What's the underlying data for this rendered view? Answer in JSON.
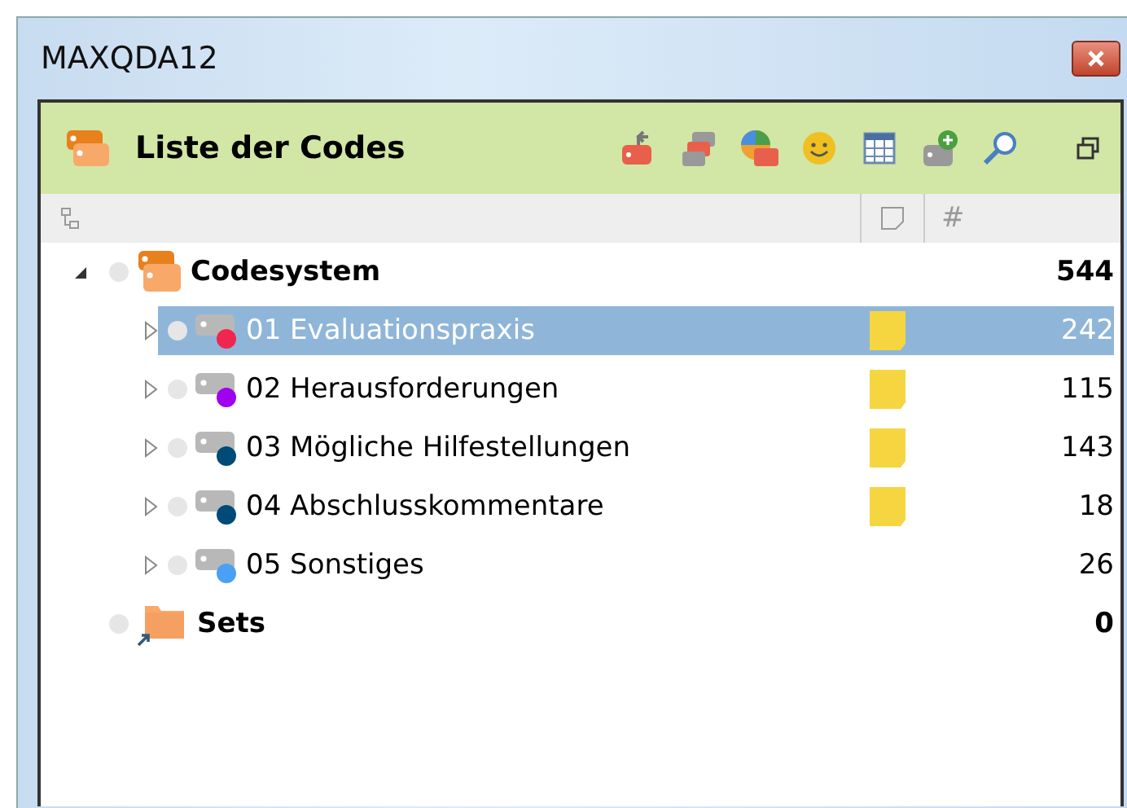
{
  "window": {
    "title": "MAXQDA12"
  },
  "panel": {
    "title": "Liste der Codes"
  },
  "columns": {
    "count_header": "#"
  },
  "tree": [
    {
      "label": "Codesystem",
      "kind": "codesystem",
      "expanded": true,
      "count": "544",
      "children": [
        {
          "label": "01 Evaluationspraxis",
          "selected": true,
          "memo": true,
          "color": "#f0264f",
          "count": "242"
        },
        {
          "label": "02 Herausforderungen",
          "selected": false,
          "memo": true,
          "color": "#a000f0",
          "count": "115"
        },
        {
          "label": "03 Mögliche Hilfestellungen",
          "selected": false,
          "memo": true,
          "color": "#004a78",
          "count": "143"
        },
        {
          "label": "04 Abschlusskommentare",
          "selected": false,
          "memo": true,
          "color": "#004a78",
          "count": "18"
        },
        {
          "label": "05 Sonstiges",
          "selected": false,
          "memo": false,
          "color": "#4aa0f5",
          "count": "26"
        }
      ]
    },
    {
      "label": "Sets",
      "kind": "sets",
      "count": "0"
    }
  ]
}
